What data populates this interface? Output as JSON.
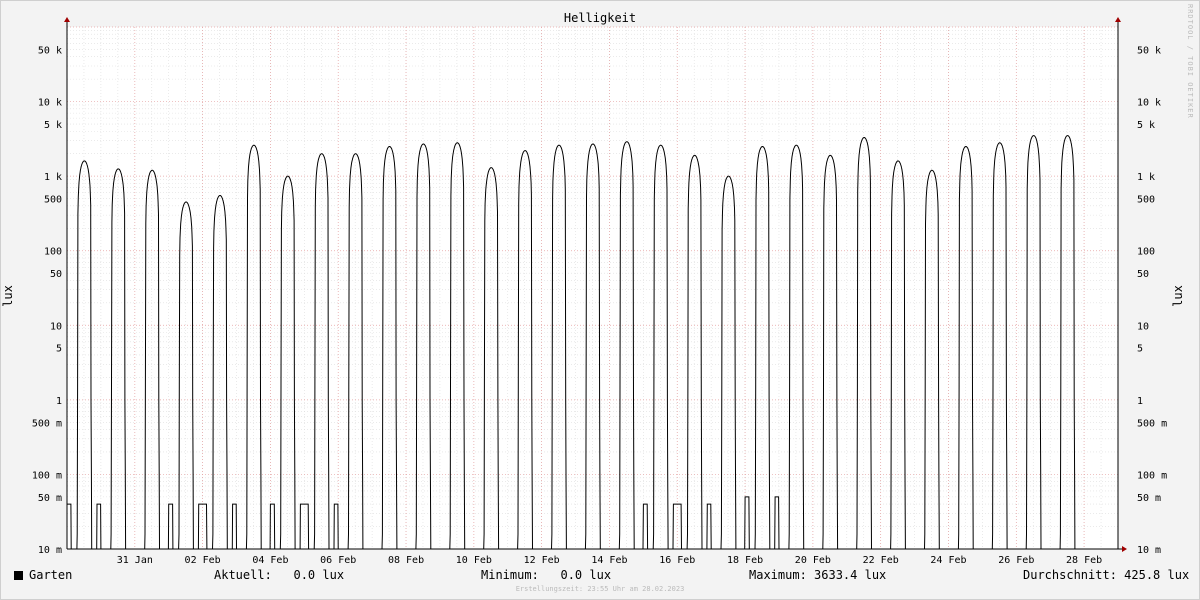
{
  "chart_data": {
    "type": "line",
    "title": "Helligkeit",
    "ylabel": "lux",
    "y_scale": "log",
    "ylim": [
      0.01,
      100000
    ],
    "y_ticks": [
      {
        "value": 50000,
        "label": "50 k"
      },
      {
        "value": 10000,
        "label": "10 k"
      },
      {
        "value": 5000,
        "label": "5 k"
      },
      {
        "value": 1000,
        "label": "1 k"
      },
      {
        "value": 500,
        "label": "500"
      },
      {
        "value": 100,
        "label": "100"
      },
      {
        "value": 50,
        "label": "50"
      },
      {
        "value": 10,
        "label": "10"
      },
      {
        "value": 5,
        "label": "5"
      },
      {
        "value": 1,
        "label": "1"
      },
      {
        "value": 0.5,
        "label": "500 m"
      },
      {
        "value": 0.1,
        "label": "100 m"
      },
      {
        "value": 0.05,
        "label": "50 m"
      },
      {
        "value": 0.01,
        "label": "10 m"
      }
    ],
    "xlim": [
      "2023-01-29T00:00",
      "2023-03-01T00:00"
    ],
    "x_ticks": [
      {
        "value": "2023-01-31",
        "label": "31 Jan"
      },
      {
        "value": "2023-02-02",
        "label": "02 Feb"
      },
      {
        "value": "2023-02-04",
        "label": "04 Feb"
      },
      {
        "value": "2023-02-06",
        "label": "06 Feb"
      },
      {
        "value": "2023-02-08",
        "label": "08 Feb"
      },
      {
        "value": "2023-02-10",
        "label": "10 Feb"
      },
      {
        "value": "2023-02-12",
        "label": "12 Feb"
      },
      {
        "value": "2023-02-14",
        "label": "14 Feb"
      },
      {
        "value": "2023-02-16",
        "label": "16 Feb"
      },
      {
        "value": "2023-02-18",
        "label": "18 Feb"
      },
      {
        "value": "2023-02-20",
        "label": "20 Feb"
      },
      {
        "value": "2023-02-22",
        "label": "22 Feb"
      },
      {
        "value": "2023-02-24",
        "label": "24 Feb"
      },
      {
        "value": "2023-02-26",
        "label": "26 Feb"
      },
      {
        "value": "2023-02-28",
        "label": "28 Feb"
      }
    ],
    "grid": true,
    "series": [
      {
        "name": "Garten",
        "color": "#000000",
        "daily_peak_lux": [
          {
            "date": "2023-01-29",
            "peak": 1600
          },
          {
            "date": "2023-01-30",
            "peak": 1250
          },
          {
            "date": "2023-01-31",
            "peak": 1200
          },
          {
            "date": "2023-02-01",
            "peak": 450
          },
          {
            "date": "2023-02-02",
            "peak": 550
          },
          {
            "date": "2023-02-03",
            "peak": 2600
          },
          {
            "date": "2023-02-04",
            "peak": 1000
          },
          {
            "date": "2023-02-05",
            "peak": 2000
          },
          {
            "date": "2023-02-06",
            "peak": 2000
          },
          {
            "date": "2023-02-07",
            "peak": 2500
          },
          {
            "date": "2023-02-08",
            "peak": 2700
          },
          {
            "date": "2023-02-09",
            "peak": 2800
          },
          {
            "date": "2023-02-10",
            "peak": 1300
          },
          {
            "date": "2023-02-11",
            "peak": 2200
          },
          {
            "date": "2023-02-12",
            "peak": 2600
          },
          {
            "date": "2023-02-13",
            "peak": 2700
          },
          {
            "date": "2023-02-14",
            "peak": 2900
          },
          {
            "date": "2023-02-15",
            "peak": 2600
          },
          {
            "date": "2023-02-16",
            "peak": 1900
          },
          {
            "date": "2023-02-17",
            "peak": 1000
          },
          {
            "date": "2023-02-18",
            "peak": 2500
          },
          {
            "date": "2023-02-19",
            "peak": 2600
          },
          {
            "date": "2023-02-20",
            "peak": 1900
          },
          {
            "date": "2023-02-21",
            "peak": 3300
          },
          {
            "date": "2023-02-22",
            "peak": 1600
          },
          {
            "date": "2023-02-23",
            "peak": 1200
          },
          {
            "date": "2023-02-24",
            "peak": 2500
          },
          {
            "date": "2023-02-25",
            "peak": 2800
          },
          {
            "date": "2023-02-26",
            "peak": 3500
          },
          {
            "date": "2023-02-27",
            "peak": 3500
          }
        ],
        "night_level_lux": [
          0.04,
          0.01,
          0.01,
          0.04,
          0.04,
          0.01,
          0.04,
          0.04,
          0.01,
          0.01,
          0.01,
          0.01,
          0.01,
          0.01,
          0.01,
          0.01,
          0.01,
          0.04,
          0.04,
          0.01,
          0.05,
          0.01,
          0.01,
          0.01,
          0.01,
          0.01,
          0.01,
          0.01,
          0.01,
          0.01
        ]
      }
    ]
  },
  "watermark": "RRDTOOL / TOBI OETIKER",
  "legend": {
    "name": "Garten",
    "aktuell_label": "Aktuell:",
    "aktuell_value": "0.0 lux",
    "minimum_label": "Minimum:",
    "minimum_value": "0.0 lux",
    "maximum_label": "Maximum:",
    "maximum_value": "3633.4 lux",
    "durchschnitt_label": "Durchschnitt:",
    "durchschnitt_value": "425.8 lux"
  },
  "footer": "Erstellungszeit: 23:55 Uhr am 28.02.2023"
}
